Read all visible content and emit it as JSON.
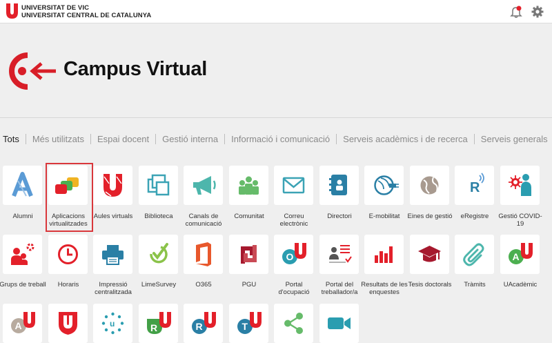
{
  "header": {
    "university_line1": "UNIVERSITAT DE VIC",
    "university_line2": "UNIVERSITAT CENTRAL DE CATALUNYA",
    "brand_color": "#e3202a"
  },
  "brand": {
    "title": "Campus Virtual"
  },
  "filters": [
    {
      "label": "Tots",
      "active": true
    },
    {
      "label": "Més utilitzats"
    },
    {
      "label": "Espai docent"
    },
    {
      "label": "Gestió interna"
    },
    {
      "label": "Informació i comunicació"
    },
    {
      "label": "Serveis acadèmics i de recerca"
    },
    {
      "label": "Serveis generals"
    }
  ],
  "apps": [
    {
      "label": "Alumni",
      "icon": "alumni-icon"
    },
    {
      "label": "Aplicacions virtualitzades",
      "icon": "virtual-apps-icon",
      "selected": true
    },
    {
      "label": "Aules virtuals",
      "icon": "virtual-classroom-icon"
    },
    {
      "label": "Biblioteca",
      "icon": "library-icon"
    },
    {
      "label": "Canals de comunicació",
      "icon": "megaphone-icon"
    },
    {
      "label": "Comunitat",
      "icon": "community-icon"
    },
    {
      "label": "Correu electrònic",
      "icon": "mail-icon"
    },
    {
      "label": "Directori",
      "icon": "directory-icon"
    },
    {
      "label": "E-mobilitat",
      "icon": "mobility-icon"
    },
    {
      "label": "Eines de gestió",
      "icon": "globe-icon"
    },
    {
      "label": "eRegistre",
      "icon": "eregistre-icon"
    },
    {
      "label": "Gestió COVID-19",
      "icon": "covid-icon"
    },
    {
      "label": "Grups de treball",
      "icon": "work-groups-icon"
    },
    {
      "label": "Horaris",
      "icon": "clock-icon"
    },
    {
      "label": "Impressió centralitzada",
      "icon": "printer-icon"
    },
    {
      "label": "LimeSurvey",
      "icon": "limesurvey-icon"
    },
    {
      "label": "O365",
      "icon": "office-icon"
    },
    {
      "label": "PGU",
      "icon": "pgu-icon"
    },
    {
      "label": "Portal d'ocupació",
      "icon": "employment-portal-icon"
    },
    {
      "label": "Portal del treballador/a",
      "icon": "worker-portal-icon"
    },
    {
      "label": "Resultats de les enquestes",
      "icon": "bar-chart-icon"
    },
    {
      "label": "Tesis doctorals",
      "icon": "graduation-cap-icon"
    },
    {
      "label": "Tràmits",
      "icon": "paperclip-icon"
    },
    {
      "label": "UAcadèmic",
      "icon": "uacademic-icon"
    },
    {
      "label": "",
      "icon": "a-u-icon"
    },
    {
      "label": "",
      "icon": "u-shield-icon"
    },
    {
      "label": "",
      "icon": "dots-u-icon"
    },
    {
      "label": "",
      "icon": "r-green-u-icon"
    },
    {
      "label": "",
      "icon": "r-blue-u-icon"
    },
    {
      "label": "",
      "icon": "t-u-icon"
    },
    {
      "label": "",
      "icon": "share-icon"
    },
    {
      "label": "",
      "icon": "video-camera-icon"
    }
  ]
}
